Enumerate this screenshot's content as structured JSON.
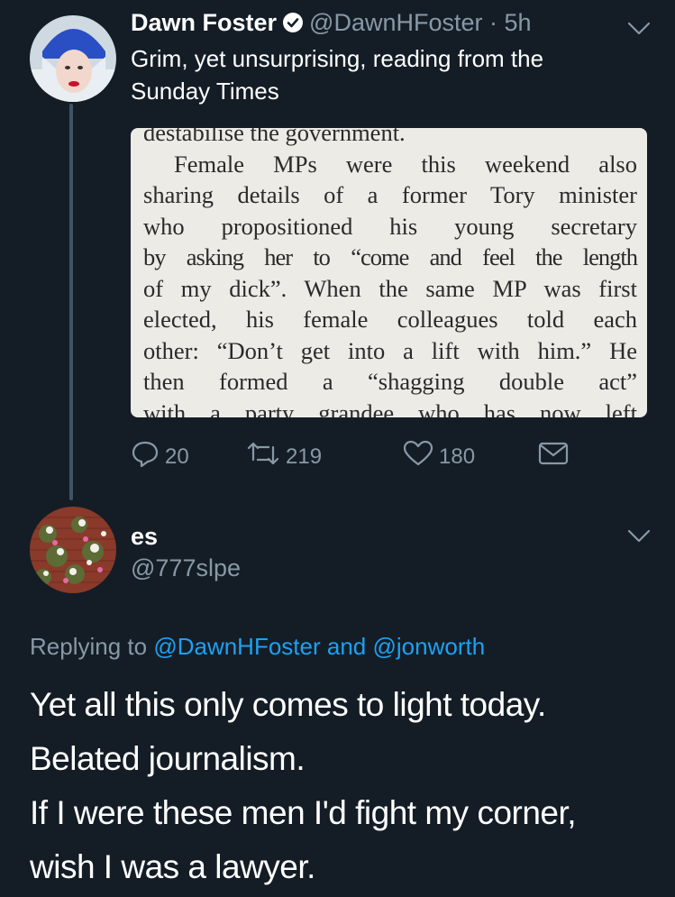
{
  "tweet": {
    "author_name": "Dawn Foster",
    "author_handle": "@DawnHFoster",
    "separator": "·",
    "timestamp": "5h",
    "text_lines": [
      "Grim, yet unsurprising, reading from the",
      "Sunday Times"
    ],
    "image_lines": [
      "destabilise the government.",
      "Female MPs were this weekend also",
      "sharing details of a former Tory minister",
      "who propositioned his young secretary",
      "by asking her to “come and feel the length",
      "of my dick”. When the same MP was first",
      "elected, his female colleagues told each",
      "other: “Don’t get into a lift with him.” He",
      "then formed a “shagging double act”",
      "with a party grandee who has now left"
    ],
    "actions": {
      "reply_count": "20",
      "retweet_count": "219",
      "like_count": "180"
    }
  },
  "reply": {
    "author_name": "es",
    "author_handle": "@777slpe",
    "replying_prefix": "Replying to",
    "replying_user1": "@DawnHFoster",
    "replying_and": "and",
    "replying_user2": "@jonworth",
    "body_lines": [
      "Yet all this only comes to light today.",
      "Belated journalism.",
      "If I were these men I'd fight my corner,",
      "wish I was a lawyer."
    ]
  },
  "colors": {
    "background": "#141d26",
    "secondary_text": "#8899a6",
    "link": "#1da1f2",
    "thread_line": "#3d5466"
  },
  "icons": {
    "verified": "verified-badge-icon",
    "more": "chevron-down-icon",
    "reply": "reply-icon",
    "retweet": "retweet-icon",
    "like": "heart-icon",
    "dm": "envelope-icon"
  }
}
